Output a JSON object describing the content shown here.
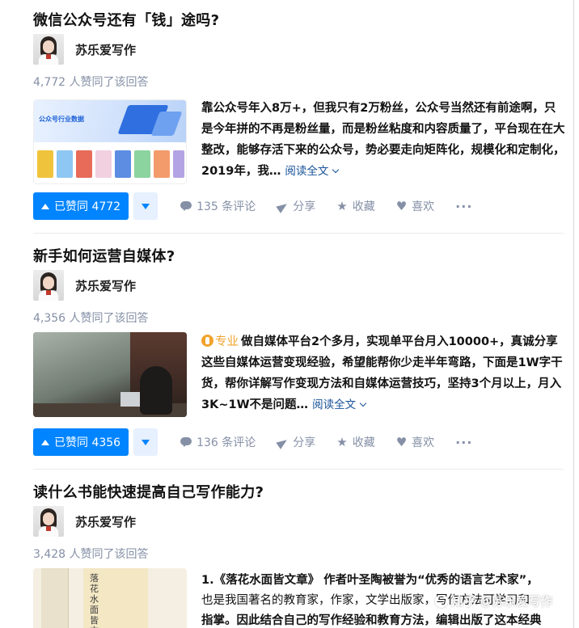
{
  "cards": [
    {
      "question_title": "微信公众号还有「钱」途吗?",
      "author_name": "苏乐爱写作",
      "votes_text": "4,772 人赞同了该回答",
      "excerpt": "靠公众号年入8万+，但我只有2万粉丝，公众号当然还有前途啊，只是今年拼的不再是粉丝量，而是粉丝粘度和内容质量了，平台现在在大整改，能够存活下来的公众号，势必要走向矩阵化，规模化和定制化，2019年，我…",
      "read_more": "阅读全文",
      "vote_label": "已赞同 4772",
      "comments": "135 条评论",
      "share": "分享",
      "collect": "收藏",
      "like": "喜欢",
      "more": "···"
    },
    {
      "question_title": "新手如何运营自媒体?",
      "author_name": "苏乐爱写作",
      "votes_text": "4,356 人赞同了该回答",
      "badge": "专业",
      "excerpt": "做自媒体平台2个多月，实现单平台月入10000+，真诚分享这些自媒体运营变现经验，希望能帮你少走半年弯路，下面是1W字干货，帮你详解写作变现方法和自媒体运营技巧，坚持3个月以上，月入3K~1W不是问题…",
      "read_more": "阅读全文",
      "vote_label": "已赞同 4356",
      "comments": "136 条评论",
      "share": "分享",
      "collect": "收藏",
      "like": "喜欢",
      "more": "···"
    },
    {
      "question_title": "读什么书能快速提高自己写作能力?",
      "author_name": "苏乐爱写作",
      "votes_text": "3,428 人赞同了该回答",
      "excerpt_line1": "1.《落花水面皆文章》 作者叶圣陶被誉为“优秀的语言艺术家”，",
      "excerpt_line2": "也是我国著名的教育家，作家，文学出版家，写作方法可学习和",
      "excerpt_line3": "指掌。因此结合自己的写作经验和教育方法，编辑出版了这本经典",
      "book_cover_text": "落花水面皆文章"
    }
  ],
  "watermark": "知乎 @苏乐爱写作",
  "colors": {
    "primary_blue": "#0084ff",
    "vote_down_bg": "#e6f0fe",
    "meta_gray": "#8590a6",
    "link_blue": "#175199",
    "badge_orange": "#f1a22b"
  }
}
